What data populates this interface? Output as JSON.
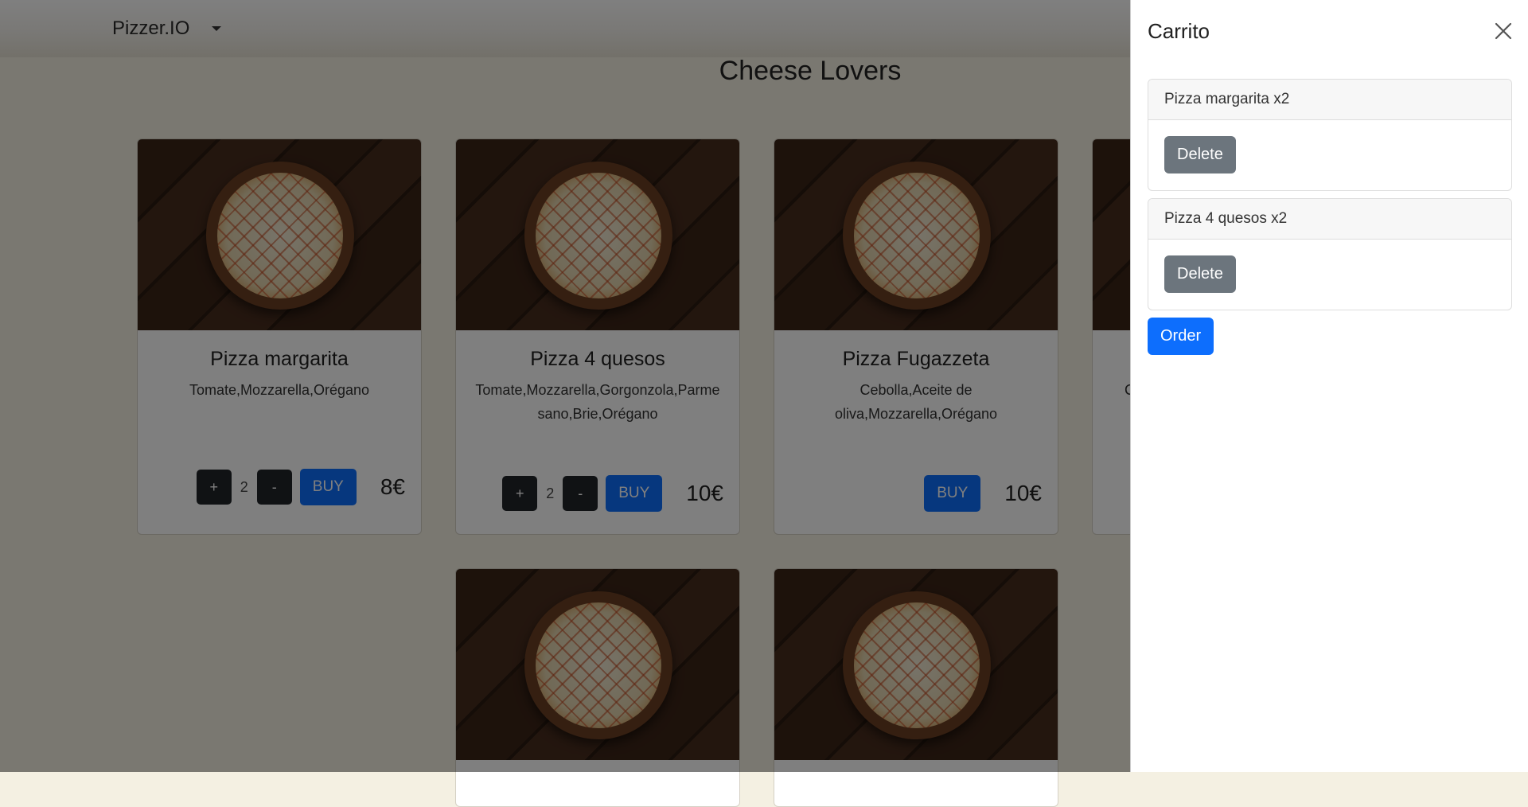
{
  "navbar": {
    "brand": "Pizzer.IO",
    "dropdown_icon": "caret-down-icon"
  },
  "page": {
    "title": "Cheese Lovers"
  },
  "products": [
    {
      "name": "Pizza margarita",
      "ingredients": "Tomate,Mozzarella,Orégano",
      "quantity": "2",
      "buy_label": "BUY",
      "price": "8€",
      "plus_label": "+",
      "minus_label": "-"
    },
    {
      "name": "Pizza 4 quesos",
      "ingredients": "Tomate,Mozzarella,Gorgonzola,Parmesano,Brie,Orégano",
      "quantity": "2",
      "buy_label": "BUY",
      "price": "10€",
      "plus_label": "+",
      "minus_label": "-"
    },
    {
      "name": "Pizza Fugazzeta",
      "ingredients": "Cebolla,Aceite de oliva,Mozzarella,Orégano",
      "buy_label": "BUY",
      "price": "10€"
    },
    {
      "ingredients": "C"
    }
  ],
  "cart": {
    "title": "Carrito",
    "close_icon": "close-icon",
    "items": [
      {
        "label": "Pizza margarita x2",
        "delete_label": "Delete"
      },
      {
        "label": "Pizza 4 quesos x2",
        "delete_label": "Delete"
      }
    ],
    "order_label": "Order"
  }
}
